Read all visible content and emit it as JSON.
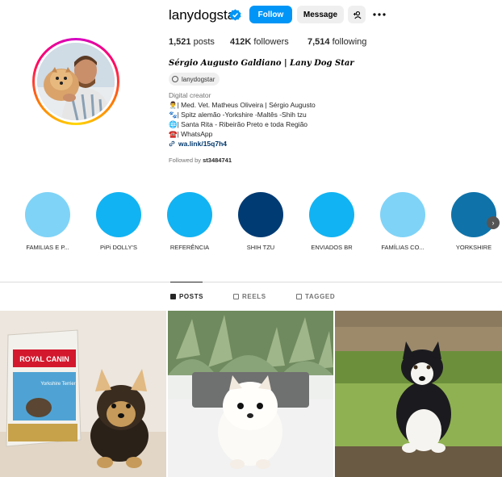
{
  "profile": {
    "username": "lanydogstar",
    "follow_label": "Follow",
    "message_label": "Message",
    "suggest_icon": "add-user-icon",
    "more_icon": "more-icon",
    "stats": {
      "posts_count": "1,521",
      "posts_label": "posts",
      "followers_count": "412K",
      "followers_label": "followers",
      "following_count": "7,514",
      "following_label": "following"
    },
    "full_name": "Sérgio Augusto Galdiano | Lany Dog Star",
    "threads_handle": "lanydogstar",
    "category": "Digital creator",
    "bio_lines": [
      "👨‍⚕️| Med. Vet. Matheus Oliveira | Sérgio Augusto",
      "🐾| Spitz alemão -Yorkshire -Maltês -Shih tzu",
      "🌐| Santa Rita - Ribeirão Preto e toda Região",
      "☎️| WhatsApp"
    ],
    "link": "wa.link/15q7h4",
    "followed_by_prefix": "Followed by",
    "followed_by_user": "st3484741"
  },
  "highlights": [
    {
      "label": "FAMILIAS E P...",
      "color": "#7fd3f7"
    },
    {
      "label": "PiPi DOLLY'S",
      "color": "#12b3f2"
    },
    {
      "label": "REFERÊNCIA",
      "color": "#12b3f2"
    },
    {
      "label": "SHIH TZU",
      "color": "#003b73"
    },
    {
      "label": "ENVIADOS BR",
      "color": "#12b3f2"
    },
    {
      "label": "FAMÍLIAS CO...",
      "color": "#7fd3f7"
    },
    {
      "label": "YORKSHIRE",
      "color": "#0f73aa"
    }
  ],
  "tabs": [
    {
      "label": "POSTS",
      "active": true
    },
    {
      "label": "REELS",
      "active": false
    },
    {
      "label": "TAGGED",
      "active": false
    }
  ],
  "posts": [
    {
      "alt": "Yorkshire puppy next to Royal Canin bag",
      "package_brand": "ROYAL CANIN",
      "package_text": "Yorkshire Terrier"
    },
    {
      "alt": "White Pomeranian puppy with succulents"
    },
    {
      "alt": "Black and white husky puppy on grass"
    }
  ],
  "colors": {
    "accent": "#0095f6",
    "verified": "#0095f6",
    "link": "#00376b"
  }
}
